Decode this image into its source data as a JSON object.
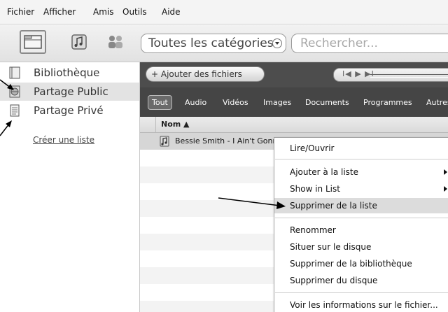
{
  "menubar": {
    "items": [
      "Fichier",
      "Afficher",
      "Amis",
      "Outils",
      "Aide"
    ]
  },
  "toolbar": {
    "buttons": [
      "library-icon",
      "music-icon",
      "friends-icon"
    ],
    "category_select": "Toutes les catégories",
    "search_placeholder": "Rechercher..."
  },
  "sidebar": {
    "items": [
      {
        "label": "Bibliothèque",
        "icon": "library-icon"
      },
      {
        "label": "Partage Public",
        "icon": "globe-icon"
      },
      {
        "label": "Partage Privé",
        "icon": "document-icon"
      }
    ],
    "create_list": "Créer une liste"
  },
  "player": {
    "add_files": "+ Ajouter des fichiers",
    "controls": "I◀ ▶ ▶I"
  },
  "filters": [
    "Tout",
    "Audio",
    "Vidéos",
    "Images",
    "Documents",
    "Programmes",
    "Autres"
  ],
  "table": {
    "column_name": "Nom ▲",
    "rows": [
      "Bessie Smith - I Ain't Gonna Play No Second Fiddle"
    ]
  },
  "context_menu": {
    "items": [
      "Lire/Ouvrir",
      "Ajouter à la liste",
      "Show in List",
      "Supprimer de la liste",
      "Renommer",
      "Situer sur le disque",
      "Supprimer de la bibliothèque",
      "Supprimer du disque",
      "Voir les informations sur le fichier..."
    ],
    "highlighted": "Supprimer de la liste"
  },
  "colors": {
    "dark_panel": "#4d4d4d",
    "filter_bar": "#454545",
    "selection": "#e3e3e3",
    "menu_highlight": "#dcdcdc",
    "annotation_arrow": "#000000"
  }
}
